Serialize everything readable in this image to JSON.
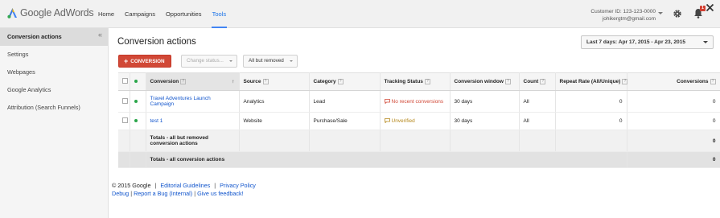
{
  "header": {
    "logo_text": "Google AdWords",
    "nav": [
      "Home",
      "Campaigns",
      "Opportunities",
      "Tools"
    ],
    "active_nav": "Tools",
    "customer_id": "Customer ID: 123-123-0000",
    "email": "johikergtm@gmail.com",
    "notification_count": "1",
    "icons": [
      "adwords-logo-icon",
      "gear-icon",
      "bell-icon",
      "close-icon",
      "chevron-down-icon"
    ]
  },
  "sidebar": {
    "collapse_label": "«",
    "items": [
      {
        "label": "Conversion actions",
        "active": true
      },
      {
        "label": "Settings"
      },
      {
        "label": "Webpages"
      },
      {
        "label": "Google Analytics"
      },
      {
        "label": "Attribution (Search Funnels)"
      }
    ]
  },
  "main": {
    "title": "Conversion actions",
    "date_range": "Last 7 days: Apr 17, 2015 - Apr 23, 2015",
    "add_button": "CONVERSION",
    "change_status": "Change status...",
    "filter": "All but removed"
  },
  "table": {
    "headers": [
      "Conversion",
      "Source",
      "Category",
      "Tracking Status",
      "Conversion window",
      "Count",
      "Repeat Rate (All/Unique)",
      "Conversions"
    ],
    "rows": [
      {
        "conversion": "Travel Adventures Launch Campaign",
        "source": "Analytics",
        "category": "Lead",
        "tracking": "No recent conversions",
        "window": "30 days",
        "count": "All",
        "repeat": "0",
        "conversions": "0"
      },
      {
        "conversion": "test 1",
        "source": "Website",
        "category": "Purchase/Sale",
        "tracking": "Unverified",
        "window": "30 days",
        "count": "All",
        "repeat": "0",
        "conversions": "0"
      }
    ],
    "totals_but_removed": {
      "label": "Totals - all but removed conversion actions",
      "conversions": "0"
    },
    "totals_all": {
      "label": "Totals - all conversion actions",
      "conversions": "0"
    }
  },
  "footer": {
    "copyright": "© 2015 Google",
    "links1": [
      "Editorial Guidelines",
      "Privacy Policy"
    ],
    "links2": [
      "Debug",
      "Report a Bug (Internal)",
      "Give us feedback!"
    ]
  },
  "colors": {
    "accent_blue": "#4285f4",
    "button_red": "#d14836",
    "status_green": "#2aa64a"
  }
}
